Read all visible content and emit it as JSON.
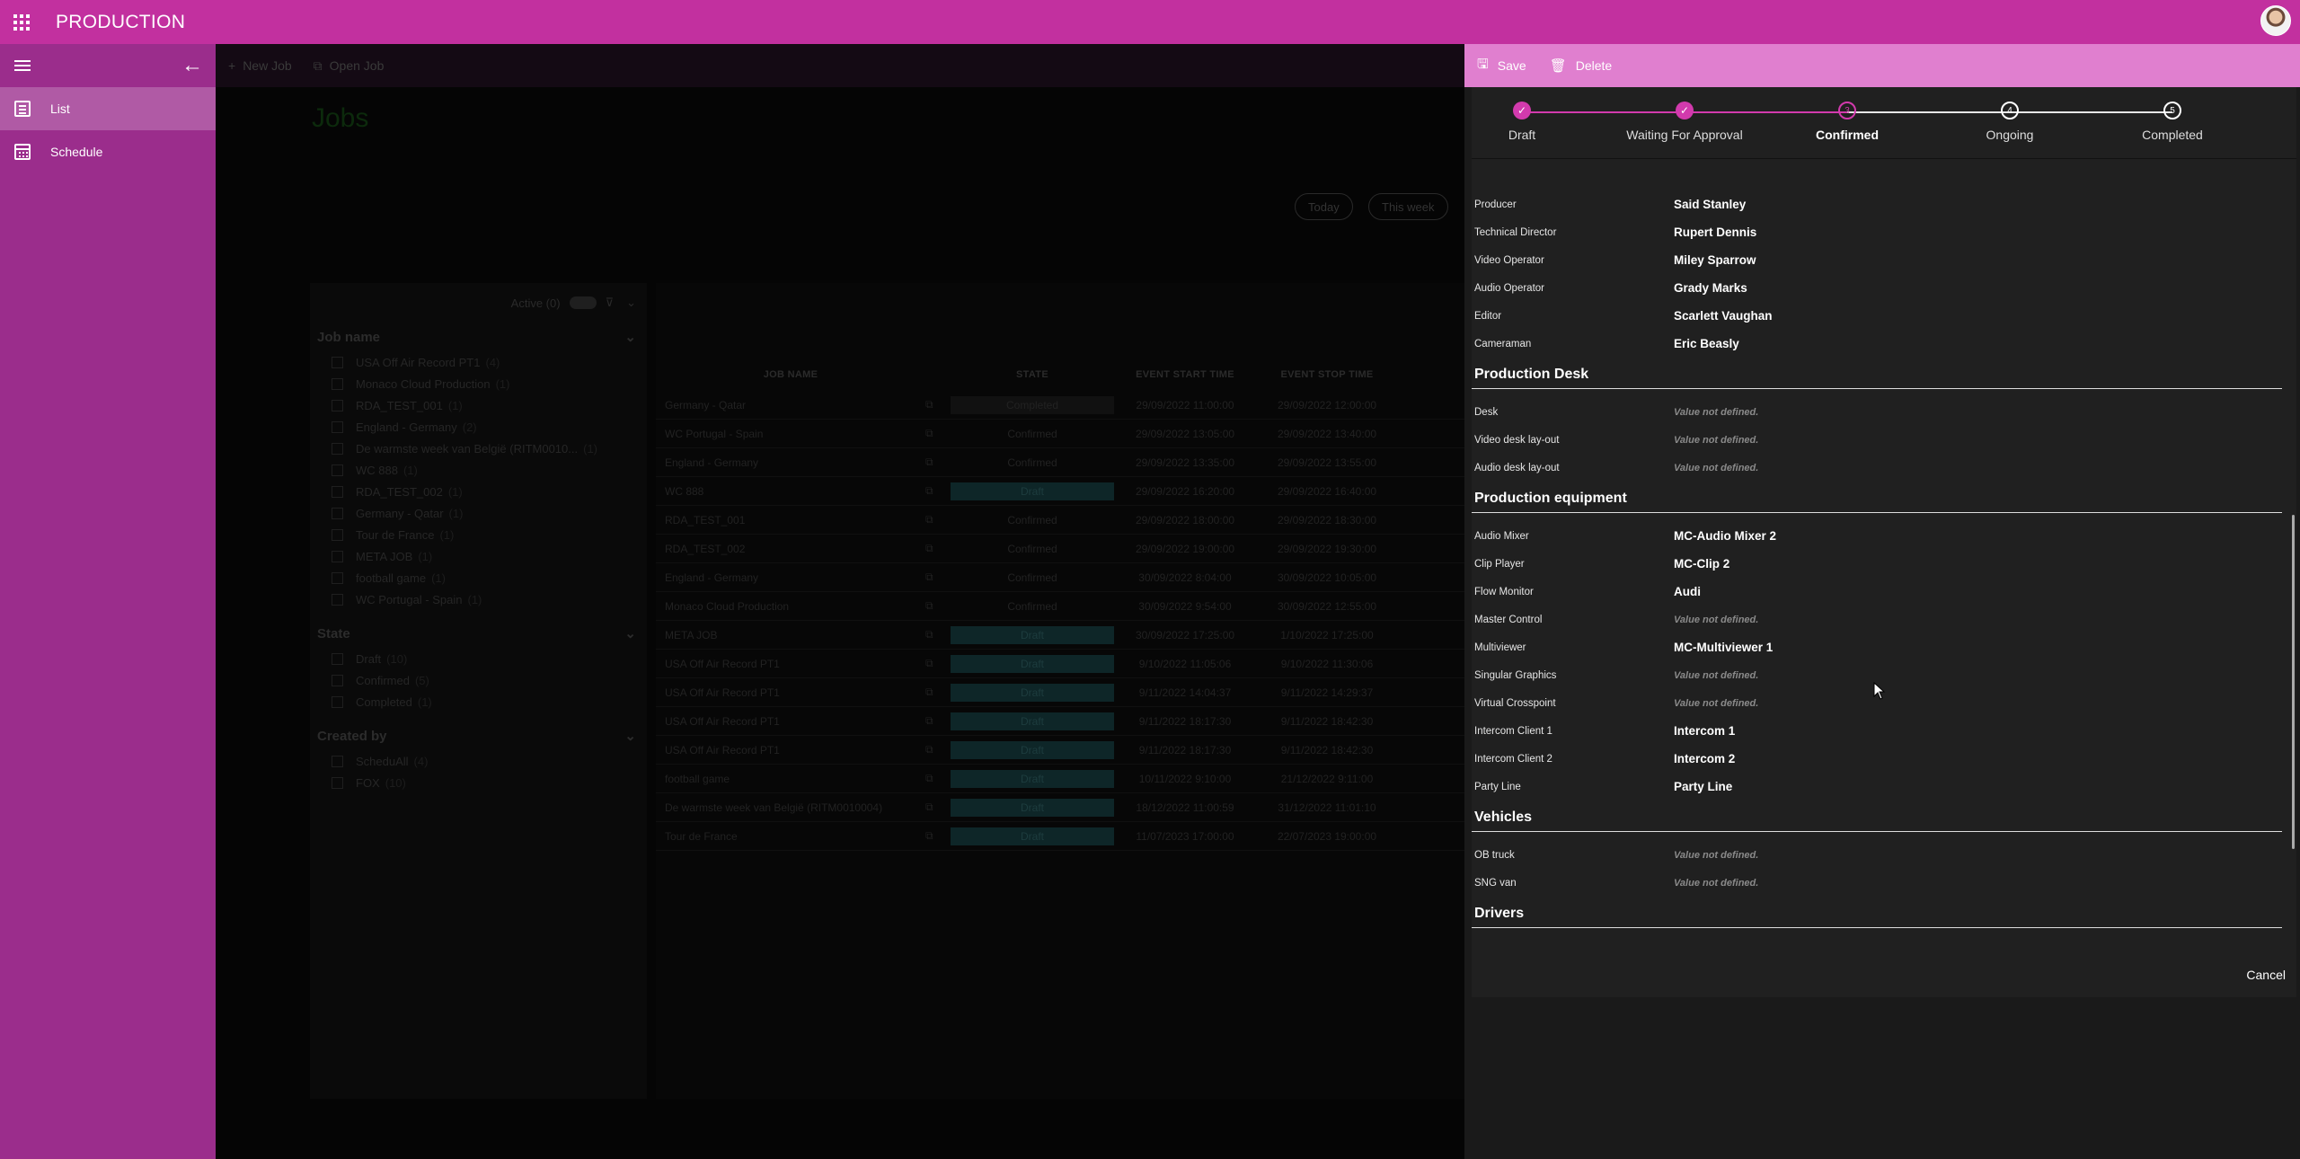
{
  "app": {
    "title": "PRODUCTION"
  },
  "sidebar": {
    "items": [
      {
        "label": "List"
      },
      {
        "label": "Schedule"
      }
    ]
  },
  "toolbar": {
    "new_job": "New Job",
    "open_job": "Open Job"
  },
  "page": {
    "title": "Jobs",
    "today": "Today",
    "this_week": "This week"
  },
  "filters": {
    "active_label": "Active (0)",
    "sections": [
      {
        "title": "Job name",
        "options": [
          {
            "label": "USA Off Air Record PT1",
            "count": "(4)"
          },
          {
            "label": "Monaco Cloud Production",
            "count": "(1)"
          },
          {
            "label": "RDA_TEST_001",
            "count": "(1)"
          },
          {
            "label": "England - Germany",
            "count": "(2)"
          },
          {
            "label": "De warmste week van België (RITM0010...",
            "count": "(1)"
          },
          {
            "label": "WC 888",
            "count": "(1)"
          },
          {
            "label": "RDA_TEST_002",
            "count": "(1)"
          },
          {
            "label": "Germany - Qatar",
            "count": "(1)"
          },
          {
            "label": "Tour de France",
            "count": "(1)"
          },
          {
            "label": "META JOB",
            "count": "(1)"
          },
          {
            "label": "football game",
            "count": "(1)"
          },
          {
            "label": "WC Portugal - Spain",
            "count": "(1)"
          }
        ]
      },
      {
        "title": "State",
        "options": [
          {
            "label": "Draft",
            "count": "(10)"
          },
          {
            "label": "Confirmed",
            "count": "(5)"
          },
          {
            "label": "Completed",
            "count": "(1)"
          }
        ]
      },
      {
        "title": "Created by",
        "options": [
          {
            "label": "ScheduAll",
            "count": "(4)"
          },
          {
            "label": "FOX",
            "count": "(10)"
          }
        ]
      }
    ]
  },
  "grid": {
    "headers": {
      "name": "JOB NAME",
      "state": "STATE",
      "start": "EVENT START TIME",
      "stop": "EVENT STOP TIME"
    },
    "rows": [
      {
        "name": "Germany - Qatar",
        "state": "Completed",
        "start": "29/09/2022 11:00:00",
        "stop": "29/09/2022 12:00:00"
      },
      {
        "name": "WC Portugal - Spain",
        "state": "Confirmed",
        "start": "29/09/2022 13:05:00",
        "stop": "29/09/2022 13:40:00"
      },
      {
        "name": "England - Germany",
        "state": "Confirmed",
        "start": "29/09/2022 13:35:00",
        "stop": "29/09/2022 13:55:00"
      },
      {
        "name": "WC 888",
        "state": "Draft",
        "start": "29/09/2022 16:20:00",
        "stop": "29/09/2022 16:40:00"
      },
      {
        "name": "RDA_TEST_001",
        "state": "Confirmed",
        "start": "29/09/2022 18:00:00",
        "stop": "29/09/2022 18:30:00"
      },
      {
        "name": "RDA_TEST_002",
        "state": "Confirmed",
        "start": "29/09/2022 19:00:00",
        "stop": "29/09/2022 19:30:00"
      },
      {
        "name": "England - Germany",
        "state": "Confirmed",
        "start": "30/09/2022 8:04:00",
        "stop": "30/09/2022 10:05:00"
      },
      {
        "name": "Monaco Cloud Production",
        "state": "Confirmed",
        "start": "30/09/2022 9:54:00",
        "stop": "30/09/2022 12:55:00"
      },
      {
        "name": "META JOB",
        "state": "Draft",
        "start": "30/09/2022 17:25:00",
        "stop": "1/10/2022 17:25:00"
      },
      {
        "name": "USA Off Air Record PT1",
        "state": "Draft",
        "start": "9/10/2022 11:05:06",
        "stop": "9/10/2022 11:30:06"
      },
      {
        "name": "USA Off Air Record PT1",
        "state": "Draft",
        "start": "9/11/2022 14:04:37",
        "stop": "9/11/2022 14:29:37"
      },
      {
        "name": "USA Off Air Record PT1",
        "state": "Draft",
        "start": "9/11/2022 18:17:30",
        "stop": "9/11/2022 18:42:30"
      },
      {
        "name": "USA Off Air Record PT1",
        "state": "Draft",
        "start": "9/11/2022 18:17:30",
        "stop": "9/11/2022 18:42:30"
      },
      {
        "name": "football game",
        "state": "Draft",
        "start": "10/11/2022 9:10:00",
        "stop": "21/12/2022 9:11:00"
      },
      {
        "name": "De warmste week van België (RITM0010004)",
        "state": "Draft",
        "start": "18/12/2022 11:00:59",
        "stop": "31/12/2022 11:01:10"
      },
      {
        "name": "Tour de France",
        "state": "Draft",
        "start": "11/07/2023 17:00:00",
        "stop": "22/07/2023 19:00:00"
      }
    ]
  },
  "panel": {
    "save": "Save",
    "delete": "Delete",
    "cancel": "Cancel",
    "steps": [
      {
        "num": "1",
        "label": "Draft",
        "status": "done"
      },
      {
        "num": "2",
        "label": "Waiting For Approval",
        "status": "done"
      },
      {
        "num": "3",
        "label": "Confirmed",
        "status": "current"
      },
      {
        "num": "4",
        "label": "Ongoing",
        "status": "todo"
      },
      {
        "num": "5",
        "label": "Completed",
        "status": "todo"
      }
    ],
    "not_defined": "Value not defined.",
    "crew": [
      {
        "key": "Producer",
        "value": "Said Stanley"
      },
      {
        "key": "Technical Director",
        "value": "Rupert Dennis"
      },
      {
        "key": "Video Operator",
        "value": "Miley Sparrow"
      },
      {
        "key": "Audio Operator",
        "value": "Grady Marks"
      },
      {
        "key": "Editor",
        "value": "Scarlett Vaughan"
      },
      {
        "key": "Cameraman",
        "value": "Eric Beasly"
      }
    ],
    "sections": [
      {
        "title": "Production Desk",
        "fields": [
          {
            "key": "Desk",
            "value": "Value not defined."
          },
          {
            "key": "Video desk lay-out",
            "value": "Value not defined."
          },
          {
            "key": "Audio desk lay-out",
            "value": "Value not defined."
          }
        ]
      },
      {
        "title": "Production equipment",
        "fields": [
          {
            "key": "Audio Mixer",
            "value": "MC-Audio Mixer 2"
          },
          {
            "key": "Clip Player",
            "value": "MC-Clip 2"
          },
          {
            "key": "Flow Monitor",
            "value": "Audi"
          },
          {
            "key": "Master Control",
            "value": "Value not defined."
          },
          {
            "key": "Multiviewer",
            "value": "MC-Multiviewer 1"
          },
          {
            "key": "Singular Graphics",
            "value": "Value not defined."
          },
          {
            "key": "Virtual Crosspoint",
            "value": "Value not defined."
          },
          {
            "key": "Intercom Client 1",
            "value": "Intercom 1"
          },
          {
            "key": "Intercom Client 2",
            "value": "Intercom 2"
          },
          {
            "key": "Party Line",
            "value": "Party Line"
          }
        ]
      },
      {
        "title": "Vehicles",
        "fields": [
          {
            "key": "OB truck",
            "value": "Value not defined."
          },
          {
            "key": "SNG van",
            "value": "Value not defined."
          }
        ]
      },
      {
        "title": "Drivers",
        "fields": []
      }
    ]
  }
}
